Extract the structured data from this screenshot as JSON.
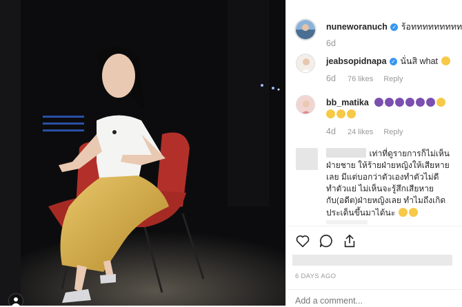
{
  "post": {
    "author": {
      "username": "nuneworanuch",
      "caption": "ร้อททททททททททท",
      "time": "6d"
    }
  },
  "comments": [
    {
      "username": "jeabsopidnapa",
      "text": "นั่นสิ what",
      "time": "6d",
      "likes": "76 likes",
      "reply_label": "Reply"
    },
    {
      "username": "bb_matika",
      "text": "",
      "time": "4d",
      "likes": "24 likes",
      "reply_label": "Reply"
    },
    {
      "username": "",
      "lines": [
        "เท่าที่ดูรายการก็ไม่เห็น",
        "ฝ่ายชาย ให้ร้ายฝ่ายหญิงให้เสียหาย",
        "เลย มีแต่บอกว่าตัวเองทำตัวไม่ดี",
        "ทำตัวแย่ ไม่เห็นจะรู้สึกเสียหาย",
        "กับ(อดีต)ฝ่ายหญิงเลย ทำไมถึงเกิด",
        "ประเด็นขึ้นมาได้นะ"
      ]
    }
  ],
  "footer": {
    "timestamp": "6 DAYS AGO",
    "add_comment_placeholder": "Add a comment..."
  },
  "colors": {
    "verified": "#3897f0",
    "chair_red": "#c0392b",
    "skirt_gold": "#d8b24a"
  }
}
